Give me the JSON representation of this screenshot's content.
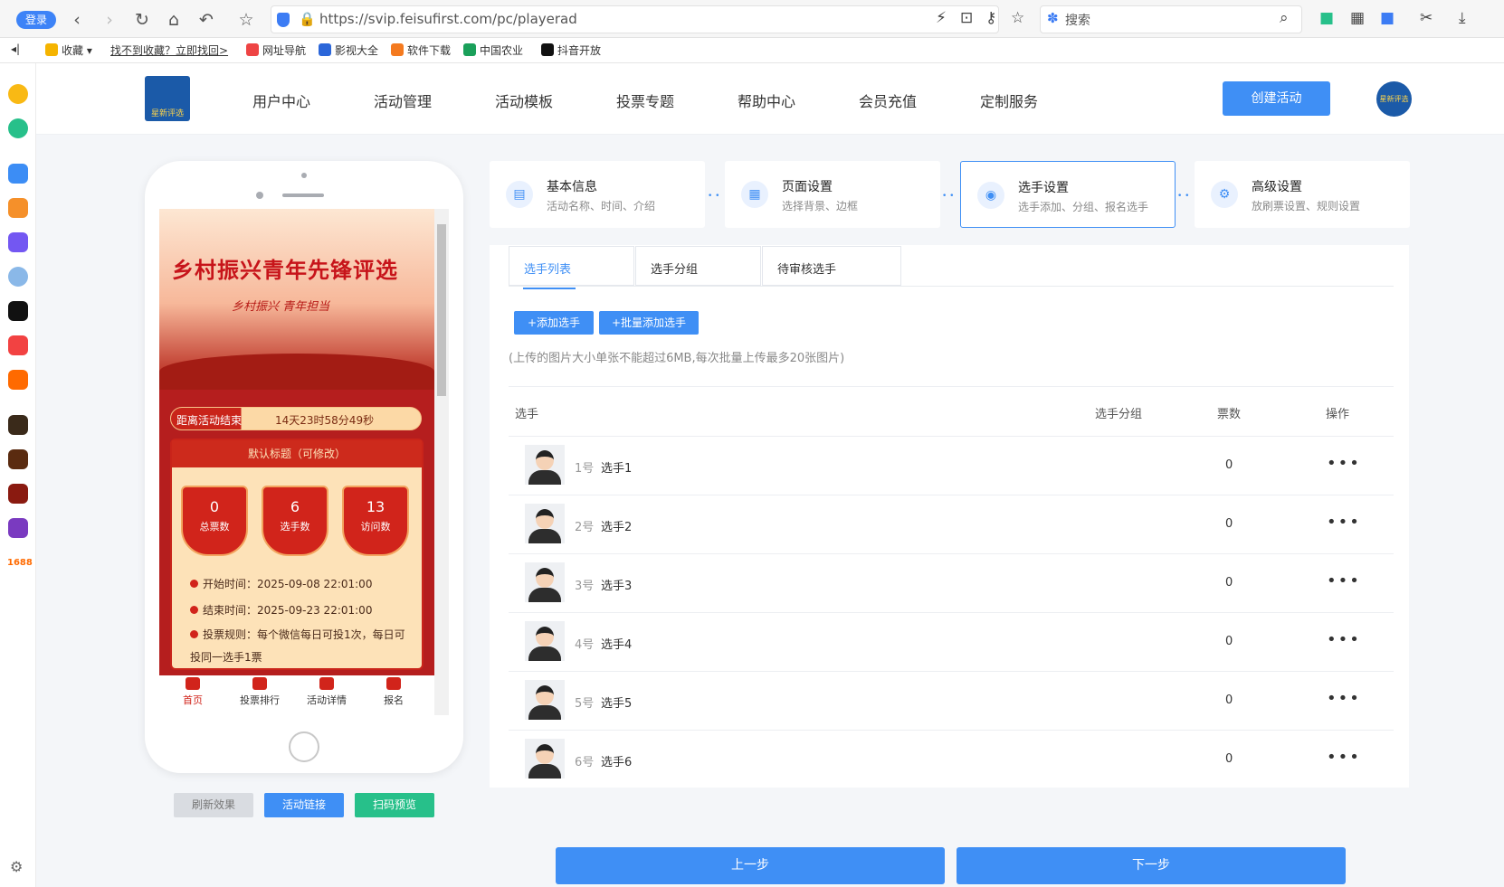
{
  "browser": {
    "login_label": "登录",
    "url": "https://svip.feisufirst.com/pc/playerad",
    "search_placeholder": "搜索",
    "bookmarks": [
      "收藏",
      "找不到收藏？立即找回>",
      "网址导航",
      "影视大全",
      "软件下载",
      "中国农业",
      "抖音开放"
    ]
  },
  "leftbar": {
    "label_1688": "1688"
  },
  "header": {
    "logo_text": "星新评选",
    "menu": [
      "用户中心",
      "活动管理",
      "活动模板",
      "投票专题",
      "帮助中心",
      "会员充值",
      "定制服务"
    ],
    "create_button": "创建活动"
  },
  "preview": {
    "title": "乡村振兴青年先锋评选",
    "subtitle": "乡村振兴  青年担当",
    "countdown_label": "距离活动结束",
    "countdown_value": "14天23时58分49秒",
    "panel_title": "默认标题（可修改）",
    "stats": [
      {
        "value": "0",
        "label": "总票数"
      },
      {
        "value": "6",
        "label": "选手数"
      },
      {
        "value": "13",
        "label": "访问数"
      }
    ],
    "start_time": "开始时间：2025-09-08 22:01:00",
    "end_time": "结束时间：2025-09-23 22:01:00",
    "rule": "投票规则：每个微信每日可投1次，每日可",
    "rule_cont": "投同一选手1票",
    "tabbar": [
      "首页",
      "投票排行",
      "活动详情",
      "报名"
    ],
    "buttons": [
      "刷新效果",
      "活动链接",
      "扫码预览"
    ]
  },
  "steps": [
    {
      "title": "基本信息",
      "desc": "活动名称、时间、介绍"
    },
    {
      "title": "页面设置",
      "desc": "选择背景、边框"
    },
    {
      "title": "选手设置",
      "desc": "选手添加、分组、报名选手"
    },
    {
      "title": "高级设置",
      "desc": "放刷票设置、规则设置"
    }
  ],
  "tabs": [
    "选手列表",
    "选手分组",
    "待审核选手"
  ],
  "actions": {
    "add": "+添加选手",
    "batch_add": "+批量添加选手",
    "hint": "(上传的图片大小单张不能超过6MB,每次批量上传最多20张图片)"
  },
  "table": {
    "headers": [
      "选手",
      "选手分组",
      "票数",
      "操作"
    ],
    "rows": [
      {
        "num": "1号",
        "name": "选手1",
        "votes": "0"
      },
      {
        "num": "2号",
        "name": "选手2",
        "votes": "0"
      },
      {
        "num": "3号",
        "name": "选手3",
        "votes": "0"
      },
      {
        "num": "4号",
        "name": "选手4",
        "votes": "0"
      },
      {
        "num": "5号",
        "name": "选手5",
        "votes": "0"
      },
      {
        "num": "6号",
        "name": "选手6",
        "votes": "0"
      }
    ],
    "more": "•••"
  },
  "footer": {
    "prev": "上一步",
    "next": "下一步"
  },
  "colors": {
    "accent": "#3f8ff5",
    "green": "#27c08a",
    "gray_button": "#d9dce1",
    "theme_red": "#d1241b"
  }
}
